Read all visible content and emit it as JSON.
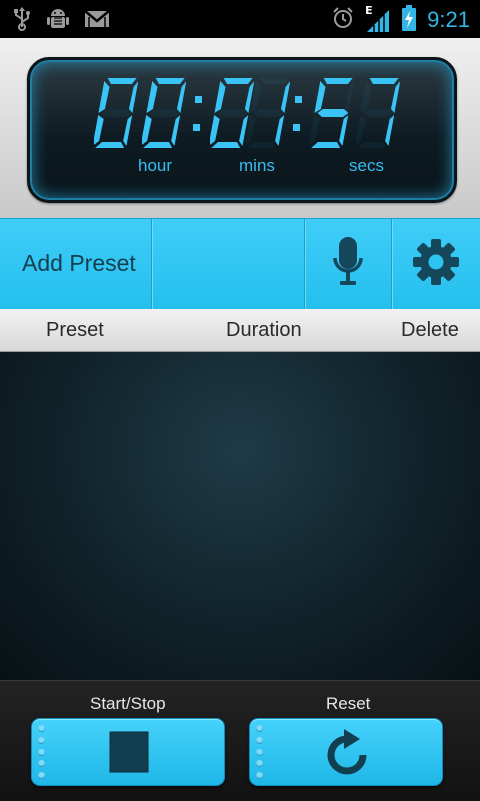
{
  "status_bar": {
    "time": "9:21",
    "network_letter": "E",
    "icons": [
      "usb-icon",
      "android-debug-icon",
      "gmail-icon",
      "alarm-icon",
      "signal-icon",
      "battery-charging-icon"
    ]
  },
  "timer": {
    "hours": "00",
    "minutes": "01",
    "seconds": "57",
    "separator": ":",
    "labels": {
      "hour": "hour",
      "mins": "mins",
      "secs": "secs"
    }
  },
  "toolbar": {
    "add_preset_label": "Add Preset",
    "icons": [
      "microphone-icon",
      "gear-icon"
    ]
  },
  "list_header": {
    "preset": "Preset",
    "duration": "Duration",
    "delete": "Delete"
  },
  "presets": [],
  "controls": {
    "start_stop_label": "Start/Stop",
    "reset_label": "Reset",
    "icons": [
      "stop-icon",
      "reset-icon"
    ]
  },
  "colors": {
    "accent": "#33b5e5",
    "lcd_digit": "#3ac3f5",
    "toolbar": "#2ec4f1"
  }
}
